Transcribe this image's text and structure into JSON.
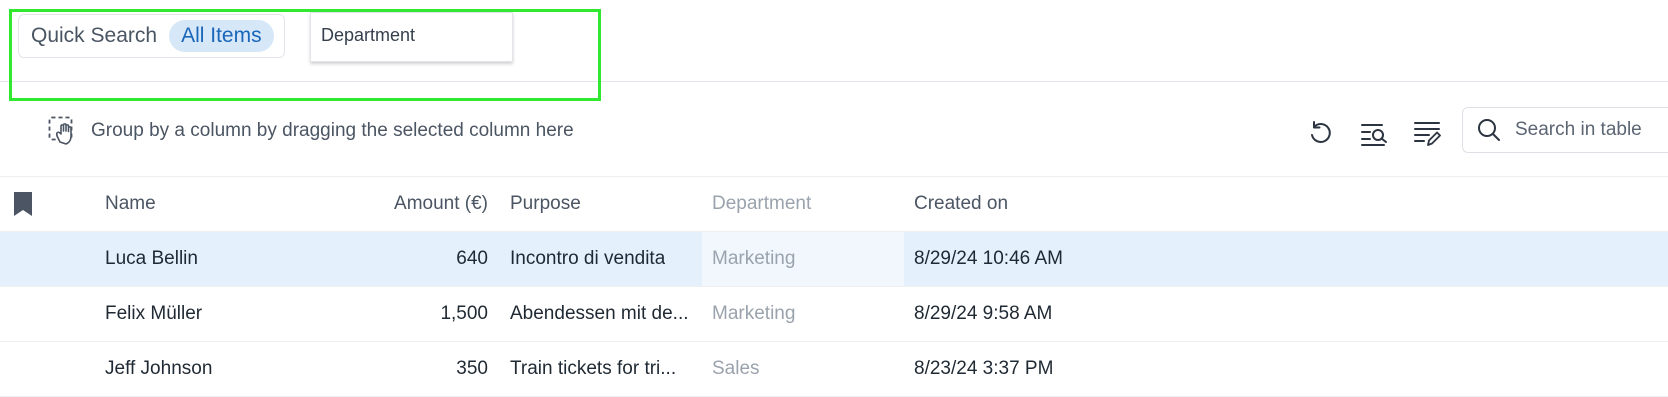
{
  "quick_search": {
    "label": "Quick Search",
    "active_chip": "All Items"
  },
  "department_dropdown": {
    "label": "Department"
  },
  "group_bar": {
    "text": "Group by a column by dragging the selected column here"
  },
  "toolbar": {
    "reset_icon": "reset-icon",
    "filter_search_icon": "filter-search-icon",
    "edit_columns_icon": "edit-columns-icon"
  },
  "search": {
    "placeholder": "Search in table"
  },
  "table": {
    "headers": {
      "name": "Name",
      "amount": "Amount (€)",
      "purpose": "Purpose",
      "department": "Department",
      "created_on": "Created on"
    },
    "rows": [
      {
        "name": "Luca Bellin",
        "amount": "640",
        "purpose": "Incontro di vendita",
        "department": "Marketing",
        "created_on": "8/29/24 10:46 AM",
        "selected": true
      },
      {
        "name": "Felix Müller",
        "amount": "1,500",
        "purpose": "Abendessen mit de...",
        "department": "Marketing",
        "created_on": "8/29/24 9:58 AM",
        "selected": false
      },
      {
        "name": "Jeff Johnson",
        "amount": "350",
        "purpose": "Train tickets for tri...",
        "department": "Sales",
        "created_on": "8/23/24 3:37 PM",
        "selected": false
      }
    ]
  },
  "colors": {
    "highlight_border": "#30e830",
    "chip_bg": "#d6e7f8",
    "chip_text": "#1a66b8",
    "selected_row": "#e4f0fb"
  }
}
